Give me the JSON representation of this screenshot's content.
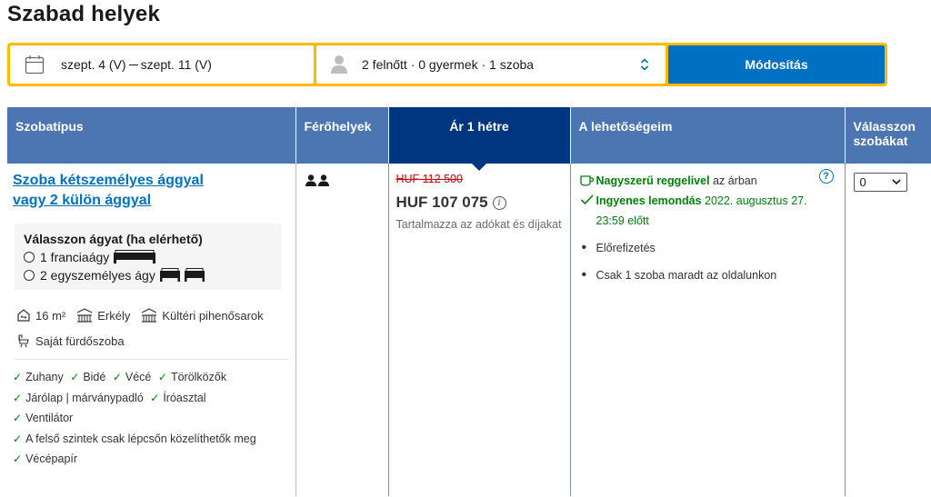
{
  "page_title": "Szabad helyek",
  "search": {
    "date_from": "szept. 4 (V)",
    "date_to": "szept. 11 (V)",
    "guests": "2 felnőtt · 0 gyermek · 1 szoba",
    "button": "Módosítás"
  },
  "table": {
    "headers": {
      "room_type": "Szobatípus",
      "capacity": "Férőhelyek",
      "price": "Ár 1 hétre",
      "options": "A lehetőségeim",
      "select": "Válasszon szobákat"
    },
    "room": {
      "name": "Szoba kétszemélyes ággyal vagy 2 külön ággyal",
      "bed_title": "Válasszon ágyat (ha elérhető)",
      "bed_options": [
        "1 franciaágy",
        "2 egyszemélyes ágy"
      ],
      "facilities": [
        "16 m²",
        "Erkély",
        "Kültéri pihenősarok",
        "Saját fürdőszoba"
      ],
      "amenities": [
        "Zuhany",
        "Bidé",
        "Vécé",
        "Törölközők",
        "Járólap | márványpadló",
        "Íróasztal",
        "Ventilátor",
        "A felső szintek csak lépcsőn közelíthetők meg",
        "Vécépapír"
      ],
      "persons": 2
    },
    "price": {
      "old": "HUF 112 500",
      "new": "HUF 107 075",
      "note": "Tartalmazza az adókat és díjakat"
    },
    "options": {
      "breakfast_bold": "Nagyszerű reggelivel",
      "breakfast_rest": "az árban",
      "cancel_bold": "Ingyenes lemondás",
      "cancel_rest": "2022. augusztus 27. 23:59 előtt",
      "bullets": [
        "Előrefizetés",
        "Csak 1 szoba maradt az oldalunkon"
      ]
    },
    "select_value": "0"
  },
  "colors": {
    "header_blue": "#4c76b2",
    "price_header": "#003580",
    "accent_yellow": "#febb02",
    "button_blue": "#0071c2",
    "green": "#008009",
    "strike_red": "#cc0000"
  }
}
